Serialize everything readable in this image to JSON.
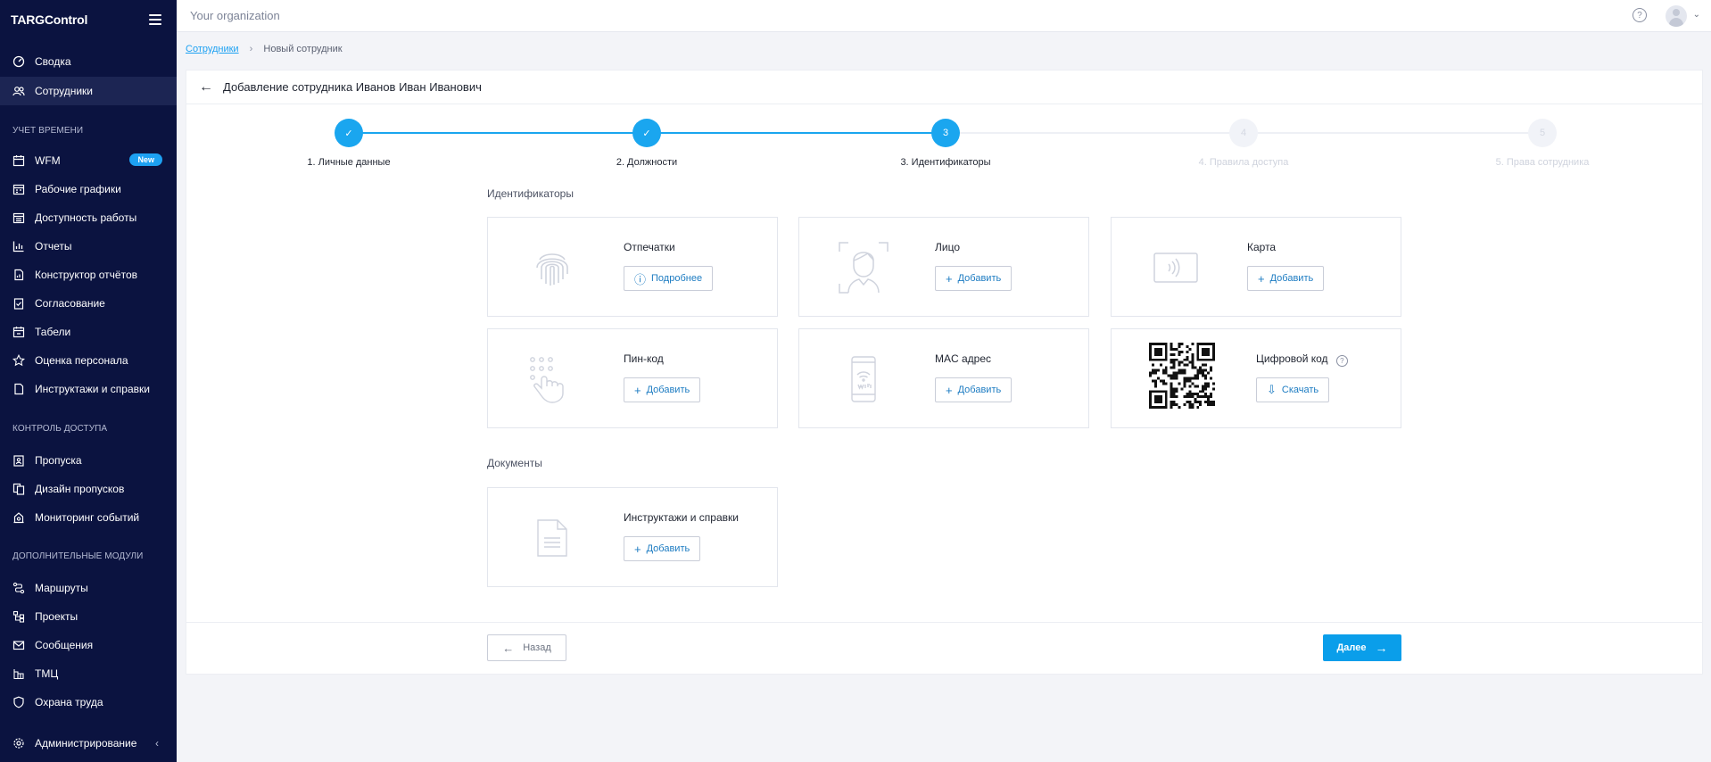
{
  "app": {
    "brand": "TARGControl",
    "organization": "Your organization"
  },
  "sidebar": {
    "top_items": [
      {
        "label": "Сводка",
        "icon": "dashboard-icon"
      },
      {
        "label": "Сотрудники",
        "icon": "users-icon",
        "active": true
      }
    ],
    "sections": [
      {
        "title": "УЧЕТ ВРЕМЕНИ",
        "items": [
          {
            "label": "WFM",
            "icon": "calendar-icon",
            "badge": "New"
          },
          {
            "label": "Рабочие графики",
            "icon": "schedule-icon"
          },
          {
            "label": "Доступность работы",
            "icon": "availability-icon"
          },
          {
            "label": "Отчеты",
            "icon": "chart-icon"
          },
          {
            "label": "Конструктор отчётов",
            "icon": "report-builder-icon"
          },
          {
            "label": "Согласование",
            "icon": "approval-icon"
          },
          {
            "label": "Табели",
            "icon": "timesheet-icon"
          },
          {
            "label": "Оценка персонала",
            "icon": "star-icon"
          },
          {
            "label": "Инструктажи и справки",
            "icon": "document-icon"
          }
        ]
      },
      {
        "title": "КОНТРОЛЬ ДОСТУПА",
        "items": [
          {
            "label": "Пропуска",
            "icon": "badge-icon"
          },
          {
            "label": "Дизайн пропусков",
            "icon": "pass-design-icon"
          },
          {
            "label": "Мониторинг событий",
            "icon": "monitoring-icon"
          }
        ]
      },
      {
        "title": "ДОПОЛНИТЕЛЬНЫЕ МОДУЛИ",
        "items": [
          {
            "label": "Маршруты",
            "icon": "route-icon"
          },
          {
            "label": "Проекты",
            "icon": "projects-icon"
          },
          {
            "label": "Сообщения",
            "icon": "mail-icon"
          },
          {
            "label": "ТМЦ",
            "icon": "inventory-icon"
          },
          {
            "label": "Охрана труда",
            "icon": "shield-icon"
          }
        ]
      }
    ],
    "admin": {
      "label": "Администрирование",
      "icon": "gear-icon",
      "chevron": "‹"
    }
  },
  "breadcrumb": {
    "parent": "Сотрудники",
    "separator": "›",
    "current": "Новый сотрудник"
  },
  "page": {
    "title": "Добавление сотрудника Иванов Иван Иванович"
  },
  "stepper": {
    "steps": [
      {
        "label": "1. Личные данные",
        "state": "done",
        "mark": "✓"
      },
      {
        "label": "2. Должности",
        "state": "done",
        "mark": "✓"
      },
      {
        "label": "3. Идентификаторы",
        "state": "current",
        "mark": "3"
      },
      {
        "label": "4. Правила доступа",
        "state": "todo",
        "mark": "4"
      },
      {
        "label": "5. Права сотрудника",
        "state": "todo",
        "mark": "5"
      }
    ],
    "active_color": "#1aa6ef"
  },
  "identifiers": {
    "title": "Идентификаторы",
    "tiles": [
      {
        "name": "Отпечатки",
        "button": "Подробнее",
        "button_icon": "ⓘ",
        "icon": "fingerprint-icon"
      },
      {
        "name": "Лицо",
        "button": "Добавить",
        "button_icon": "+",
        "icon": "face-icon"
      },
      {
        "name": "Карта",
        "button": "Добавить",
        "button_icon": "+",
        "icon": "card-icon"
      },
      {
        "name": "Пин-код",
        "button": "Добавить",
        "button_icon": "+",
        "icon": "keypad-icon"
      },
      {
        "name": "MAC адрес",
        "button": "Добавить",
        "button_icon": "+",
        "icon": "phone-wifi-icon"
      },
      {
        "name": "Цифровой код",
        "button": "Скачать",
        "button_icon": "⇩",
        "icon": "qr-code-icon",
        "help": "?"
      }
    ]
  },
  "documents": {
    "title": "Документы",
    "tiles": [
      {
        "name": "Инструктажи и справки",
        "button": "Добавить",
        "button_icon": "+",
        "icon": "document-icon"
      }
    ]
  },
  "footer": {
    "back_label": "Назад",
    "next_label": "Далее",
    "back_icon": "←",
    "next_icon": "→"
  },
  "topbar": {
    "help_icon": "?",
    "avatar_chevron": "⌄"
  }
}
